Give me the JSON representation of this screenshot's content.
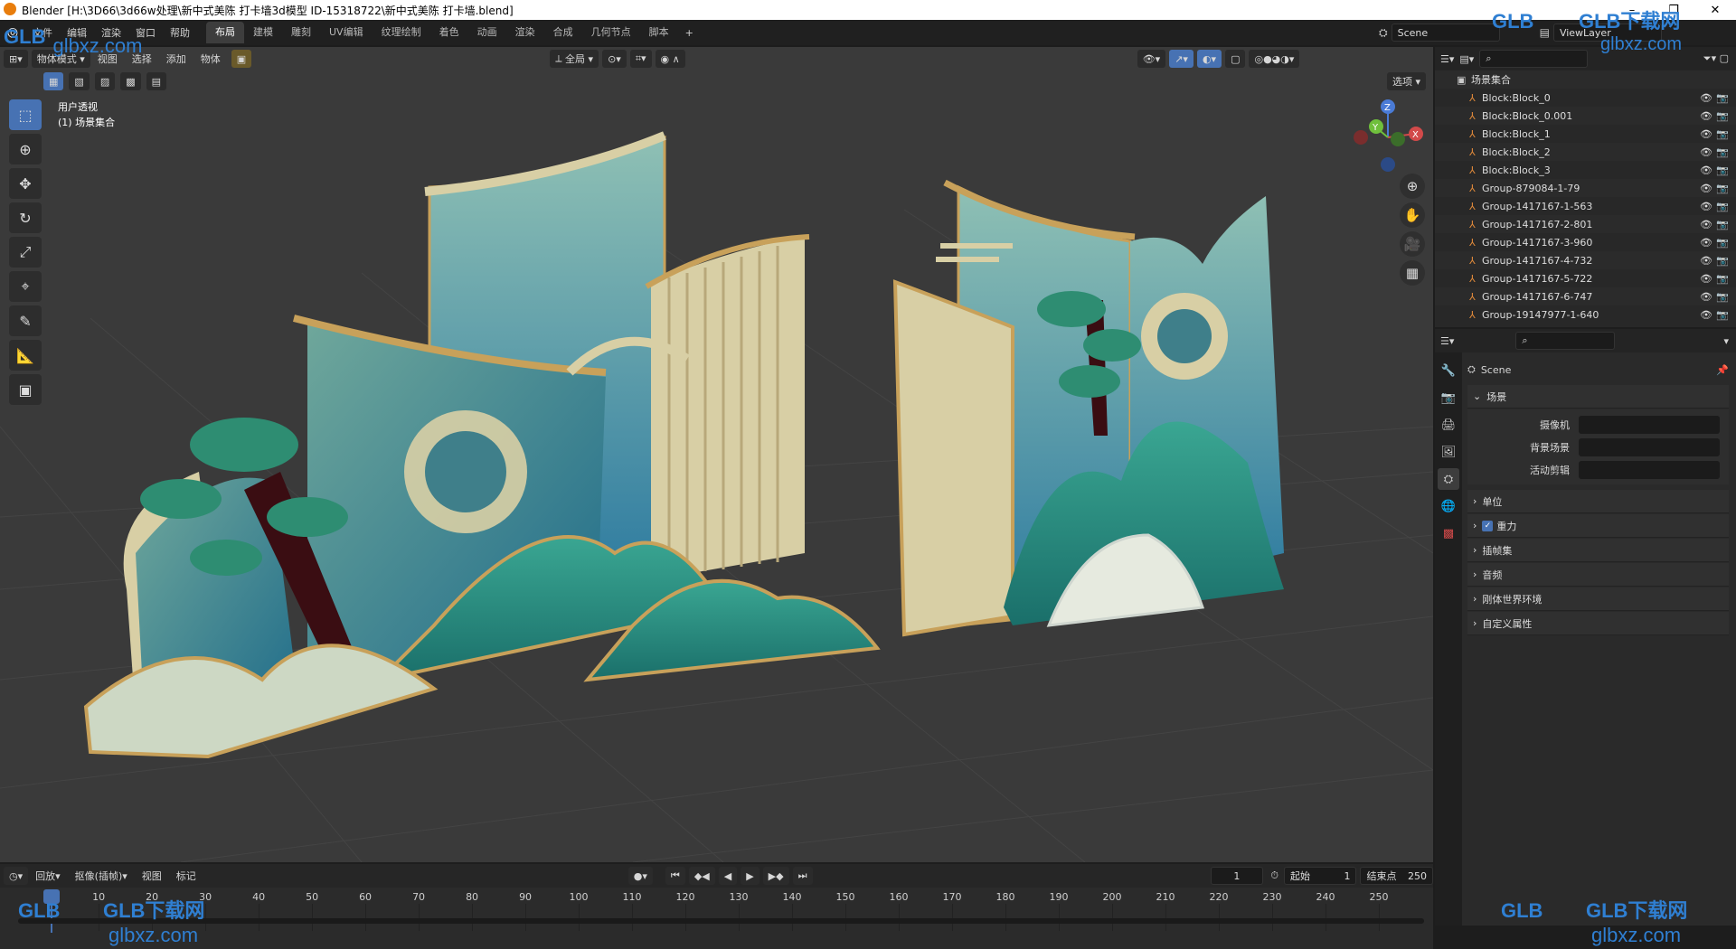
{
  "window": {
    "title": "Blender [H:\\3D66\\3d66w处理\\新中式美陈 打卡墙3d模型 ID-15318722\\新中式美陈 打卡墙.blend]",
    "controls": [
      "–",
      "❐",
      "✕"
    ]
  },
  "menu": [
    "文件",
    "编辑",
    "渲染",
    "窗口",
    "帮助"
  ],
  "workspaces": [
    "布局",
    "建模",
    "雕刻",
    "UV编辑",
    "纹理绘制",
    "着色",
    "动画",
    "渲染",
    "合成",
    "几何节点",
    "脚本"
  ],
  "active_workspace_index": 0,
  "scene_field": "Scene",
  "viewlayer_field": "ViewLayer",
  "viewport": {
    "mode": "物体模式",
    "menus": [
      "视图",
      "选择",
      "添加",
      "物体"
    ],
    "transform_orientation": "全局",
    "options_label": "选项",
    "overlay_title": "用户透视",
    "overlay_collection": "(1) 场景集合",
    "axis_labels": {
      "x": "X",
      "y": "Y",
      "z": "Z"
    }
  },
  "outliner": {
    "root": "场景集合",
    "items": [
      "Block:Block_0",
      "Block:Block_0.001",
      "Block:Block_1",
      "Block:Block_2",
      "Block:Block_3",
      "Group-879084-1-79",
      "Group-1417167-1-563",
      "Group-1417167-2-801",
      "Group-1417167-3-960",
      "Group-1417167-4-732",
      "Group-1417167-5-722",
      "Group-1417167-6-747",
      "Group-19147977-1-640"
    ]
  },
  "properties": {
    "scene_name": "Scene",
    "section_title": "场景",
    "fields": [
      {
        "label": "摄像机",
        "value": ""
      },
      {
        "label": "背景场景",
        "value": ""
      },
      {
        "label": "活动剪辑",
        "value": ""
      }
    ],
    "panels": [
      "单位",
      "重力",
      "插帧集",
      "音频",
      "刚体世界环境",
      "自定义属性"
    ],
    "gravity_checked": true
  },
  "timeline": {
    "menus": [
      "回放",
      "抠像(插帧)",
      "视图",
      "标记"
    ],
    "current_frame": "1",
    "start_label": "起始",
    "start_value": "1",
    "end_label": "结束点",
    "end_value": "250",
    "ticks": [
      "1",
      "10",
      "20",
      "30",
      "40",
      "50",
      "60",
      "70",
      "80",
      "90",
      "100",
      "110",
      "120",
      "130",
      "140",
      "150",
      "160",
      "170",
      "180",
      "190",
      "200",
      "210",
      "220",
      "230",
      "240",
      "250"
    ]
  },
  "watermark": {
    "brand": "GLB下载网",
    "url": "glbxz.com",
    "logo": "GLB"
  },
  "colors": {
    "accent": "#4772b3",
    "viewport_bg": "#3a3a3a",
    "teal": "#2f8c86",
    "gold": "#c8a15a",
    "cream": "#d8cfa5"
  }
}
